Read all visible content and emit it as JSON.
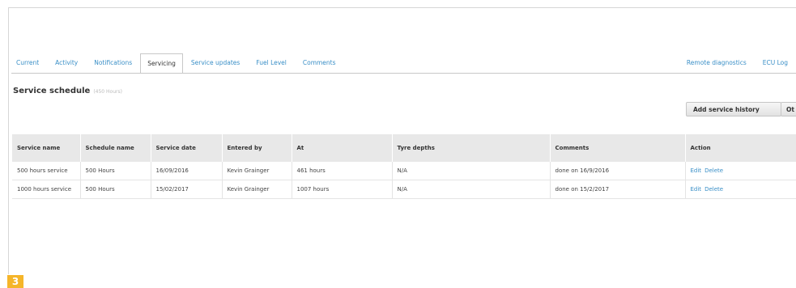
{
  "tabs": [
    {
      "label": "Current",
      "active": false
    },
    {
      "label": "Activity",
      "active": false
    },
    {
      "label": "Notifications",
      "active": false
    },
    {
      "label": "Servicing",
      "active": true
    },
    {
      "label": "Service updates",
      "active": false
    },
    {
      "label": "Fuel Level",
      "active": false
    },
    {
      "label": "Comments",
      "active": false
    }
  ],
  "right_tabs": [
    {
      "label": "Remote diagnostics"
    },
    {
      "label": "ECU Log"
    }
  ],
  "section": {
    "title": "Service schedule",
    "subtitle": "(450 Hours)"
  },
  "buttons": {
    "add_service_history": "Add service history",
    "extra": "Ot"
  },
  "table": {
    "headers": [
      "Service name",
      "Schedule name",
      "Service date",
      "Entered by",
      "At",
      "Tyre depths",
      "Comments",
      "Action"
    ],
    "rows": [
      {
        "service_name": "500 hours service",
        "schedule_name": "500 Hours",
        "service_date": "16/09/2016",
        "entered_by": "Kevin Grainger",
        "at": "461 hours",
        "tyre_depths": "N/A",
        "comments": "done on 16/9/2016",
        "edit": "Edit",
        "delete": "Delete"
      },
      {
        "service_name": "1000 hours service",
        "schedule_name": "500 Hours",
        "service_date": "15/02/2017",
        "entered_by": "Kevin Grainger",
        "at": "1007 hours",
        "tyre_depths": "N/A",
        "comments": "done on 15/2/2017",
        "edit": "Edit",
        "delete": "Delete"
      }
    ]
  },
  "figure_badge": "3",
  "colors": {
    "link": "#3a8fc7",
    "header_bg": "#e8e8e8",
    "badge": "#f5b52a"
  }
}
